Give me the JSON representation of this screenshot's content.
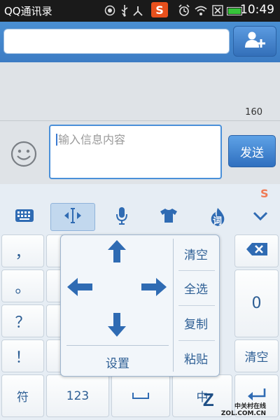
{
  "status_bar": {
    "app_title": "QQ通讯录",
    "time": "10:49",
    "sogou_badge": "S",
    "icons": [
      "record-icon",
      "usb-icon",
      "network-icon",
      "sogou-icon",
      "alarm-icon",
      "wifi-icon",
      "signal-off-icon",
      "battery-icon"
    ]
  },
  "header": {
    "search_value": "",
    "add_contact_icon": "add-contact-icon"
  },
  "message_area": {
    "char_count": "160"
  },
  "compose": {
    "emoji_icon": "smiley-icon",
    "input_placeholder": "输入信息内容",
    "send_label": "发送"
  },
  "keyboard": {
    "logo": "S",
    "toolbar": [
      "keyboard-icon",
      "text-cursor-icon",
      "microphone-icon",
      "tshirt-skin-icon",
      "ci-flame-icon",
      "chevron-down-icon"
    ],
    "ci_label": "词",
    "left_keys": [
      "，",
      "。",
      "？",
      "！"
    ],
    "right_keys": {
      "delete_icon": "backspace-icon",
      "zero": "0",
      "clear": "清空"
    },
    "bottom_keys": {
      "symbol": "符",
      "num": "123",
      "space": "␣",
      "cn": "中",
      "enter_icon": "enter-icon"
    },
    "edit_popup": {
      "items": [
        "清空",
        "全选",
        "复制",
        "粘贴"
      ],
      "setting": "设置",
      "arrows": [
        "arrow-up-icon",
        "arrow-left-icon",
        "arrow-right-icon",
        "arrow-down-icon"
      ]
    }
  },
  "watermark": {
    "line1": "中关村在线",
    "line2": "ZOL.COM.CN",
    "logo": "Z"
  }
}
